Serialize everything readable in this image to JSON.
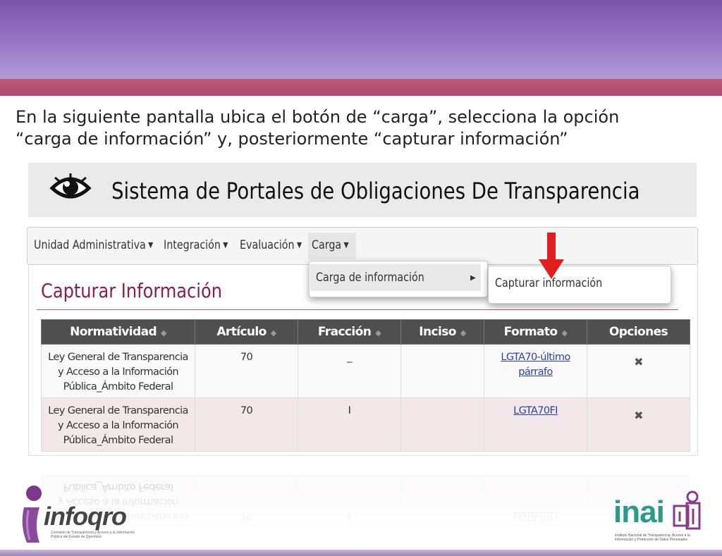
{
  "instruction": {
    "line1": "En la siguiente pantalla ubica el botón de “carga”, selecciona la opción",
    "line2": "“carga de información” y, posteriormente “capturar información”"
  },
  "portal": {
    "title": "Sistema de Portales de Obligaciones De Transparencia",
    "icon": "eye-icon"
  },
  "nav": {
    "items": [
      {
        "label": "Unidad Administrativa"
      },
      {
        "label": "Integración"
      },
      {
        "label": "Evaluación"
      },
      {
        "label": "Carga"
      }
    ]
  },
  "dropdown": {
    "carga_item": "Carga de información",
    "submenu_item": "Capturar información"
  },
  "page": {
    "heading": "Capturar Información"
  },
  "table": {
    "headers": [
      "Normatividad",
      "Artículo",
      "Fracción",
      "Inciso",
      "Formato",
      "Opciones"
    ],
    "rows": [
      {
        "normatividad": "Ley General de Transparencia y Acceso a la Información Pública_Ámbito Federal",
        "articulo": "70",
        "fraccion": "_",
        "inciso": "",
        "formato": "LGTA70-último párrafo",
        "opciones": "✖"
      },
      {
        "normatividad": "Ley General de Transparencia y Acceso a la Información Pública_Ámbito Federal",
        "articulo": "70",
        "fraccion": "I",
        "inciso": "",
        "formato": "LGTA70FI",
        "opciones": "✖"
      }
    ]
  },
  "logos": {
    "left_word": "infoqro",
    "left_tagline": "Comisión de Transparencia y Acceso a la Información Pública del Estado de Querétaro",
    "right_word": "inai",
    "right_tagline": "Instituto Nacional de Transparencia, Acceso a la Información y Protección de Datos Personales"
  },
  "colors": {
    "accent": "#8a1d4e",
    "header_band": "#7a55a9",
    "stripe": "#c0587a",
    "arrow": "#e02020",
    "inai": "#2a9a8a"
  }
}
